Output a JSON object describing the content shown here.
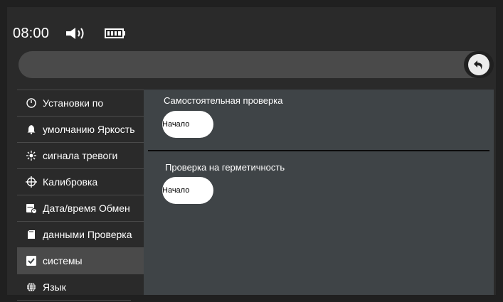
{
  "status": {
    "time": "08:00",
    "icons": [
      "speaker-icon",
      "battery-icon"
    ]
  },
  "sidebar": {
    "items": [
      {
        "label": "Установки по",
        "icon": "gauge-icon"
      },
      {
        "label": "умолчанию Яркость",
        "icon": "bell-icon"
      },
      {
        "label": "сигнала тревоги",
        "icon": "brightness-icon"
      },
      {
        "label": "Калибровка",
        "icon": "crosshair-icon"
      },
      {
        "label": "Дата/время Обмен",
        "icon": "calendar-clock-icon"
      },
      {
        "label": "данными Проверка",
        "icon": "sd-card-icon"
      },
      {
        "label": "системы",
        "icon": "checkbox-icon",
        "active": true
      },
      {
        "label": "Язык",
        "icon": "globe-icon"
      }
    ]
  },
  "main": {
    "self_test": {
      "title": "Самостоятельная проверка",
      "button": "Начало"
    },
    "seal_test": {
      "title": "Проверка на герметичность",
      "button": "Начало"
    }
  },
  "colors": {
    "background": "#202020",
    "panel": "#3f4447",
    "bar": "#4a4a4a",
    "button": "#ffffff"
  }
}
